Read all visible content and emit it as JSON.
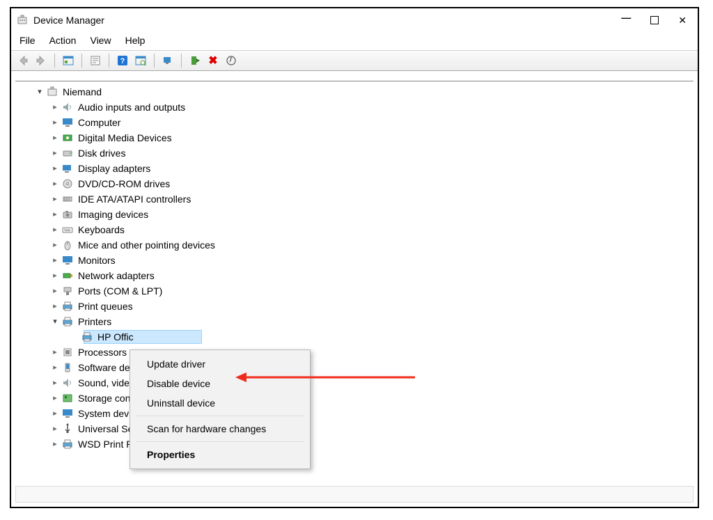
{
  "window": {
    "title": "Device Manager"
  },
  "menubar": {
    "file": "File",
    "action": "Action",
    "view": "View",
    "help": "Help"
  },
  "tree": {
    "root": "Niemand",
    "items": [
      "Audio inputs and outputs",
      "Computer",
      "Digital Media Devices",
      "Disk drives",
      "Display adapters",
      "DVD/CD-ROM drives",
      "IDE ATA/ATAPI controllers",
      "Imaging devices",
      "Keyboards",
      "Mice and other pointing devices",
      "Monitors",
      "Network adapters",
      "Ports (COM & LPT)",
      "Print queues",
      "Printers",
      "Processors",
      "Software dev",
      "Sound, video",
      "Storage cont",
      "System devic",
      "Universal Ser",
      "WSD Print Provider"
    ],
    "printers_child": "HP Offic"
  },
  "context_menu": {
    "update": "Update driver",
    "disable": "Disable device",
    "uninstall": "Uninstall device",
    "scan": "Scan for hardware changes",
    "properties": "Properties"
  }
}
